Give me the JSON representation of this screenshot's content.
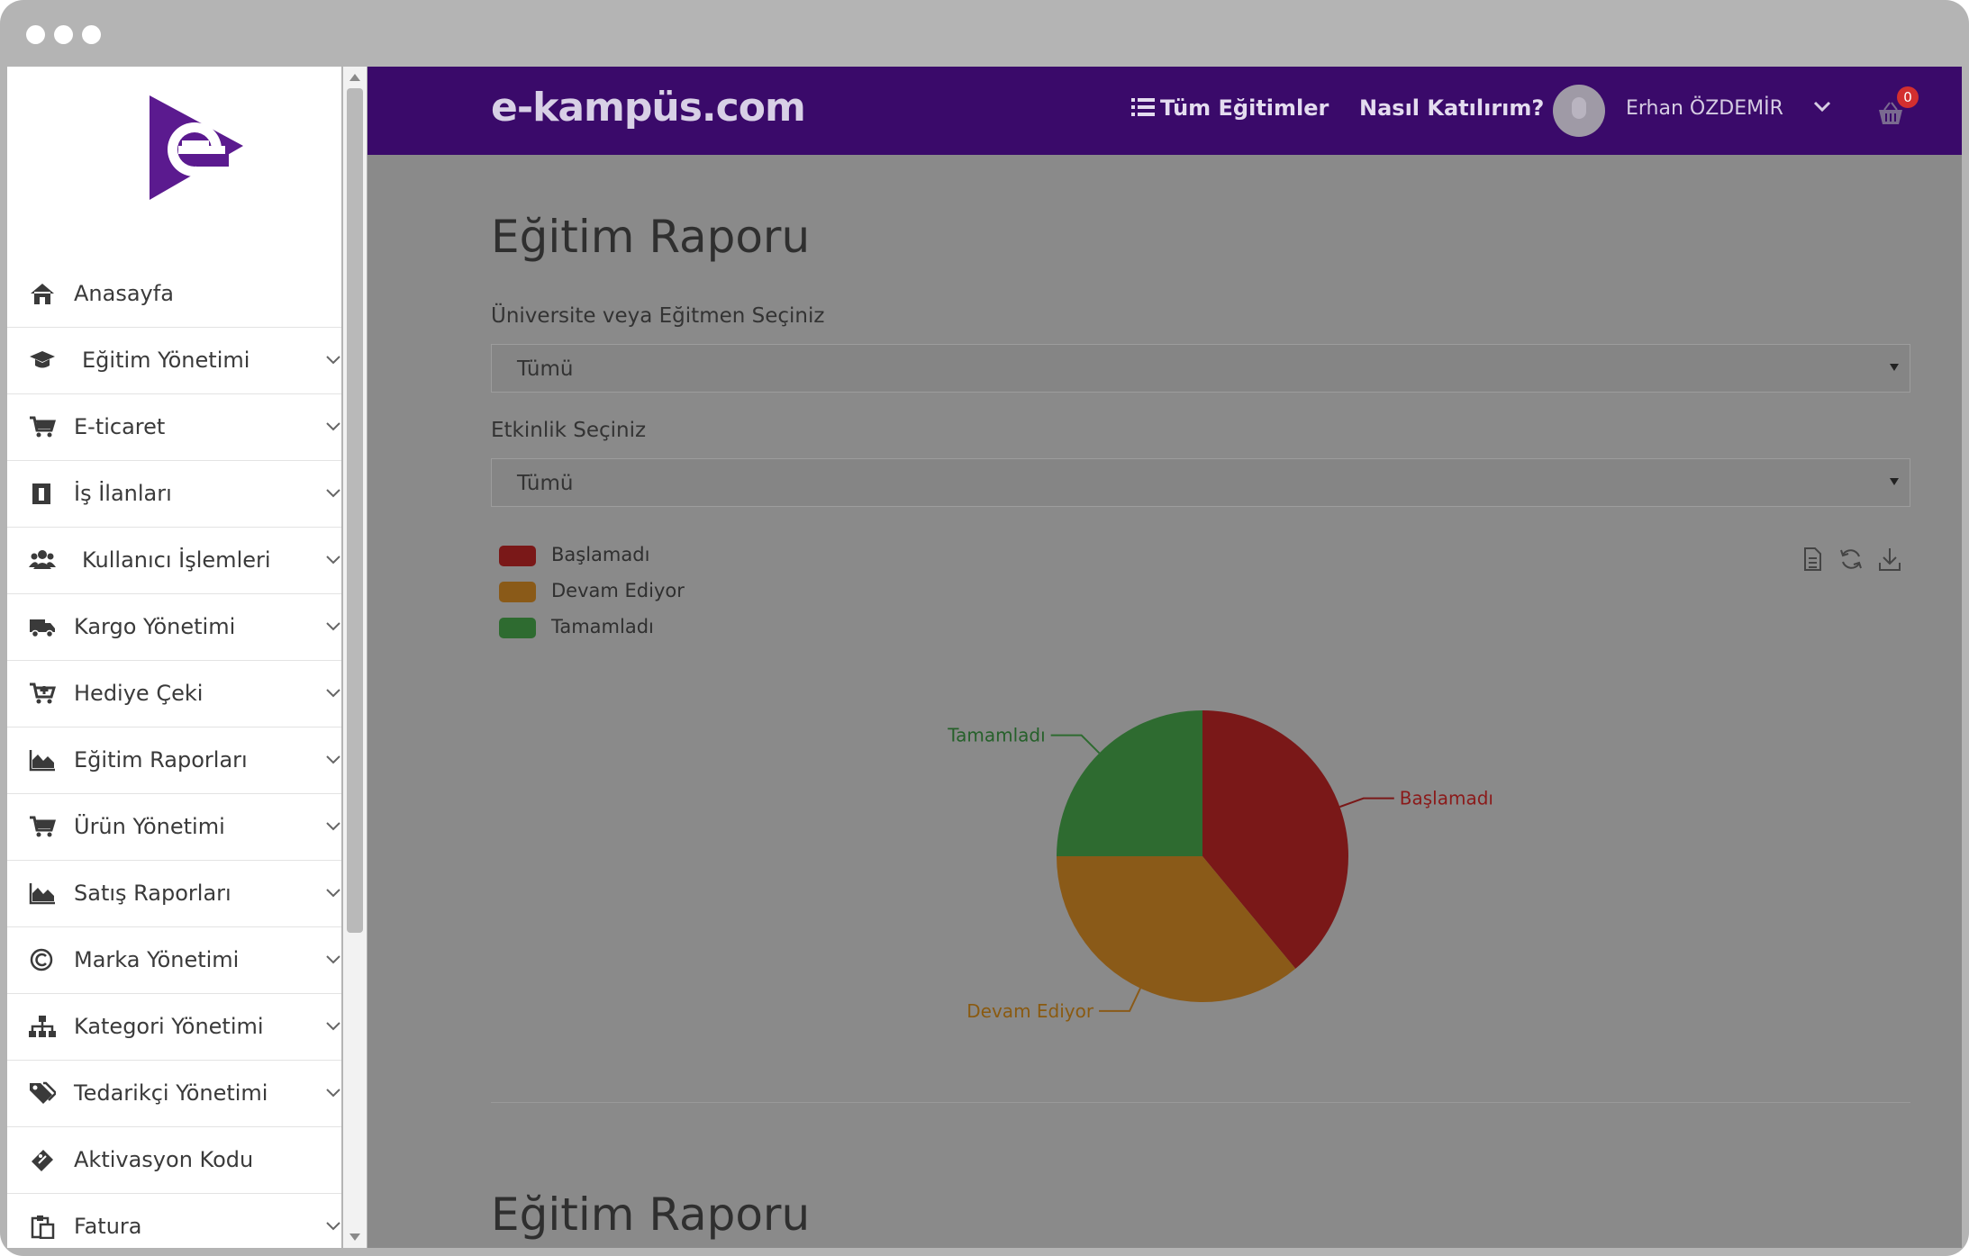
{
  "brand": {
    "name": "e-kampüs.com"
  },
  "header": {
    "all_courses": "Tüm Eğitimler",
    "how_to_join": "Nasıl Katılırım?",
    "username": "Erhan ÖZDEMİR",
    "cart_count": "0"
  },
  "sidebar": {
    "items": [
      {
        "label": "Anasayfa",
        "icon": "home-icon",
        "has_submenu": false
      },
      {
        "label": "Eğitim Yönetimi",
        "icon": "graduation-cap-icon",
        "has_submenu": true
      },
      {
        "label": "E-ticaret",
        "icon": "shopping-cart-icon",
        "has_submenu": true
      },
      {
        "label": "İş İlanları",
        "icon": "id-badge-icon",
        "has_submenu": true
      },
      {
        "label": "Kullanıcı İşlemleri",
        "icon": "users-icon",
        "has_submenu": true
      },
      {
        "label": "Kargo Yönetimi",
        "icon": "truck-icon",
        "has_submenu": true
      },
      {
        "label": "Hediye Çeki",
        "icon": "cart-plus-icon",
        "has_submenu": true
      },
      {
        "label": "Eğitim Raporları",
        "icon": "area-chart-icon",
        "has_submenu": true
      },
      {
        "label": "Ürün Yönetimi",
        "icon": "shopping-cart-icon",
        "has_submenu": true
      },
      {
        "label": "Satış Raporları",
        "icon": "area-chart-icon",
        "has_submenu": true
      },
      {
        "label": "Marka Yönetimi",
        "icon": "copyright-icon",
        "has_submenu": true
      },
      {
        "label": "Kategori Yönetimi",
        "icon": "sitemap-icon",
        "has_submenu": true
      },
      {
        "label": "Tedarikçi Yönetimi",
        "icon": "tags-icon",
        "has_submenu": true
      },
      {
        "label": "Aktivasyon Kodu",
        "icon": "ticket-icon",
        "has_submenu": false
      },
      {
        "label": "Fatura",
        "icon": "clipboard-icon",
        "has_submenu": true
      }
    ]
  },
  "main": {
    "title": "Eğitim Raporu",
    "university_label": "Üniversite veya Eğitmen Seçiniz",
    "university_value": "Tümü",
    "activity_label": "Etkinlik Seçiniz",
    "activity_value": "Tümü",
    "second_title": "Eğitim Raporu"
  },
  "colors": {
    "topbar": "#3a0a6a",
    "logo": "#5b1a8f",
    "not_started": "#7a1818",
    "in_progress": "#8a5a18",
    "completed": "#2e6b30"
  },
  "chart_data": {
    "type": "pie",
    "title": "",
    "legend_position": "top-left",
    "slices": [
      {
        "label": "Başlamadı",
        "value": 39,
        "color": "#7a1818",
        "label_color": "#8b1a1a"
      },
      {
        "label": "Devam Ediyor",
        "value": 36,
        "color": "#8a5a18",
        "label_color": "#8a5a10"
      },
      {
        "label": "Tamamladı",
        "value": 25,
        "color": "#2e6b30",
        "label_color": "#25602a"
      }
    ],
    "toolbox": [
      "data-view-icon",
      "restore-icon",
      "save-image-icon"
    ]
  }
}
